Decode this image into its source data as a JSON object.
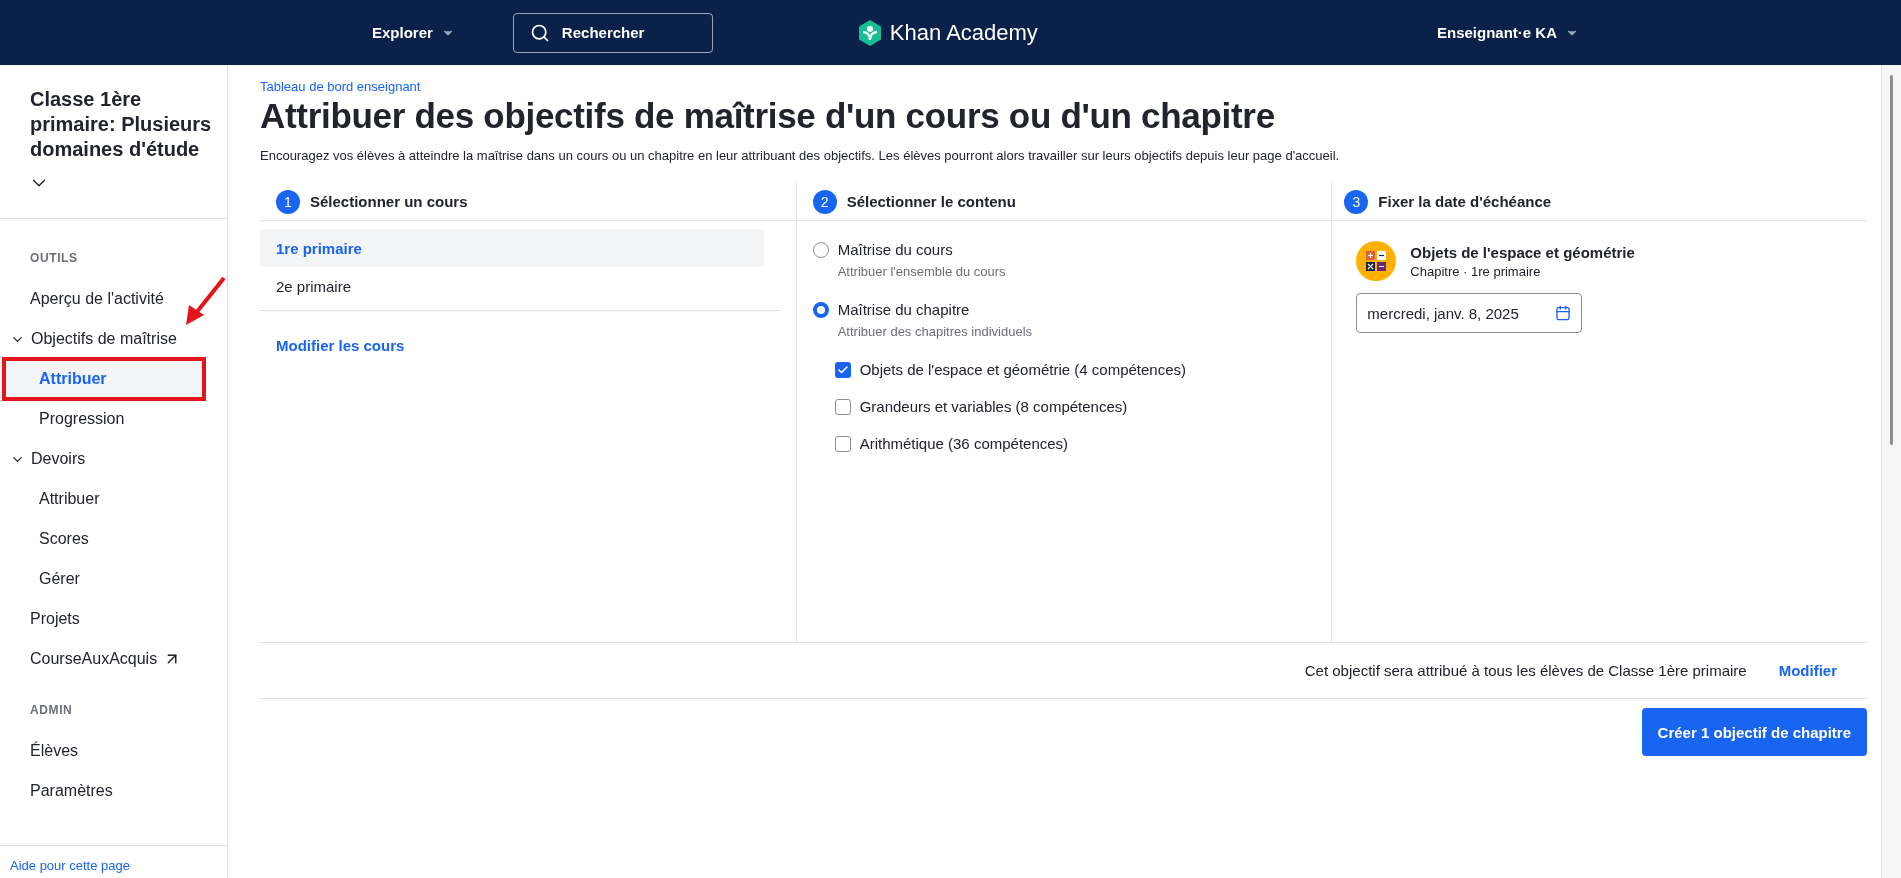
{
  "topbar": {
    "explore": "Explorer",
    "search": {
      "placeholder": "Rechercher"
    },
    "logo": "Khan Academy",
    "user": "Enseignant·e KA"
  },
  "sidebar": {
    "class_title": "Classe 1ère primaire: Plusieurs domaines d'étude",
    "sections": [
      {
        "heading": "OUTILS",
        "items": [
          {
            "kind": "link",
            "label": "Aperçu de l'activité"
          },
          {
            "kind": "group",
            "label": "Objectifs de maîtrise",
            "expanded": true,
            "children": [
              {
                "label": "Attribuer",
                "selected": true,
                "highlighted": true
              },
              {
                "label": "Progression",
                "selected": false,
                "highlighted": false
              }
            ]
          },
          {
            "kind": "group",
            "label": "Devoirs",
            "expanded": true,
            "children": [
              {
                "label": "Attribuer",
                "selected": false,
                "highlighted": false
              },
              {
                "label": "Scores",
                "selected": false,
                "highlighted": false
              },
              {
                "label": "Gérer",
                "selected": false,
                "highlighted": false
              }
            ]
          },
          {
            "kind": "link",
            "label": "Projets"
          },
          {
            "kind": "external",
            "label": "CourseAuxAcquis"
          }
        ]
      },
      {
        "heading": "ADMIN",
        "items": [
          {
            "kind": "link",
            "label": "Élèves"
          },
          {
            "kind": "link",
            "label": "Paramètres"
          }
        ]
      }
    ],
    "help": "Aide pour cette page"
  },
  "main": {
    "breadcrumb": "Tableau de bord enseignant",
    "title": "Attribuer des objectifs de maîtrise d'un cours ou d'un chapitre",
    "description": "Encouragez vos élèves à atteindre la maîtrise dans un cours ou un chapitre en leur attribuant des objectifs. Les élèves pourront alors travailler sur leurs objectifs depuis leur page d'accueil.",
    "steps": [
      {
        "number": "1",
        "title": "Sélectionner un cours"
      },
      {
        "number": "2",
        "title": "Sélectionner le contenu"
      },
      {
        "number": "3",
        "title": "Fixer la date d'échéance"
      }
    ],
    "courses": [
      {
        "label": "1re primaire",
        "selected": true
      },
      {
        "label": "2e primaire",
        "selected": false
      }
    ],
    "edit_courses": "Modifier les cours",
    "content_options": [
      {
        "label": "Maîtrise du cours",
        "hint": "Attribuer l'ensemble du cours",
        "selected": false
      },
      {
        "label": "Maîtrise du chapitre",
        "hint": "Attribuer des chapitres individuels",
        "selected": true
      }
    ],
    "chapters": [
      {
        "label": "Objets de l'espace et géométrie (4 compétences)",
        "checked": true
      },
      {
        "label": "Grandeurs et variables (8 compétences)",
        "checked": false
      },
      {
        "label": "Arithmétique (36 compétences)",
        "checked": false
      }
    ],
    "due": {
      "title": "Objets de l'espace et géométrie",
      "subtitle": "Chapitre · 1re primaire",
      "date": "mercredi, janv. 8, 2025"
    },
    "assign_note": "Cet objectif sera attribué à tous les élèves de Classe 1ère primaire",
    "modify": "Modifier",
    "create_button": "Créer 1 objectif de chapitre"
  }
}
